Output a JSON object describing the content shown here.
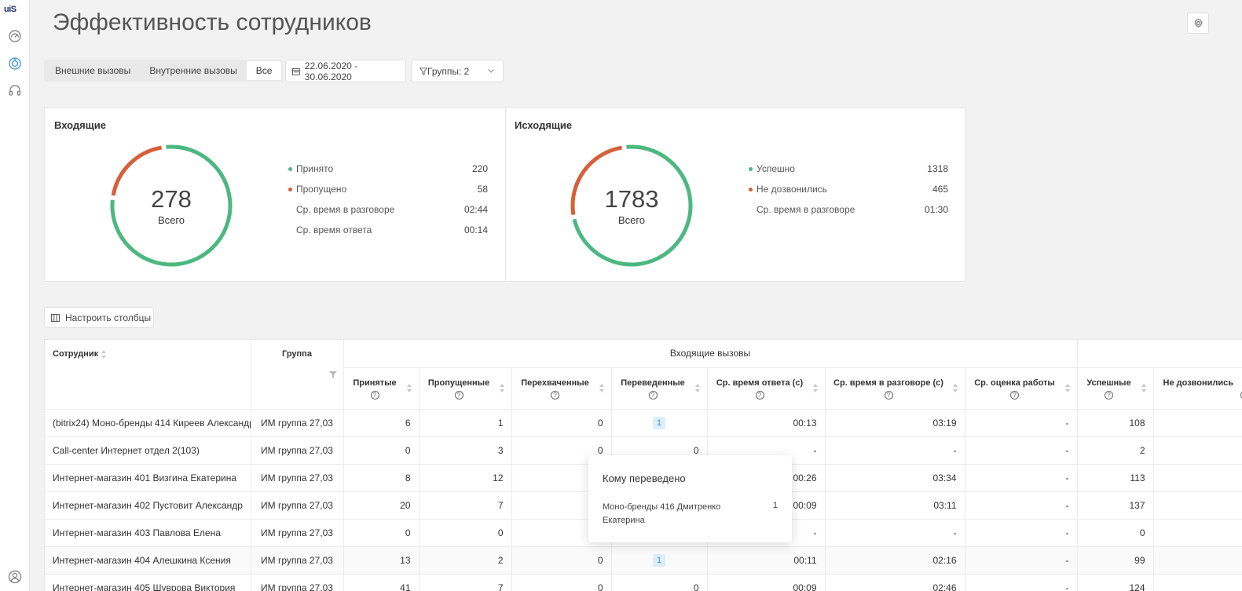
{
  "app": {
    "logo": "uiЅ"
  },
  "sidebar": {
    "icons": [
      "dashboard-icon",
      "analytics-icon",
      "headset-icon",
      "profile-icon"
    ],
    "accent": "#3b8fd2"
  },
  "header": {
    "title": "Эффективность сотрудников"
  },
  "filters": {
    "call_types": [
      "Внешние вызовы",
      "Внутренние вызовы",
      "Все"
    ],
    "selected_call_type": "Все",
    "date_range": "22.06.2020 - 30.06.2020",
    "groups": "Группы: 2"
  },
  "colors": {
    "success": "#4cb880",
    "failure": "#d5603a"
  },
  "incoming": {
    "title": "Входящие",
    "total": "278",
    "total_label": "Всего",
    "accepted_value": 220,
    "missed_value": 58,
    "legend": [
      {
        "label": "Принято",
        "value": "220",
        "color": "#4cb880"
      },
      {
        "label": "Пропущено",
        "value": "58",
        "color": "#d5603a"
      },
      {
        "label": "Ср. время в разговоре",
        "value": "02:44"
      },
      {
        "label": "Ср. время ответа",
        "value": "00:14"
      }
    ]
  },
  "outgoing": {
    "title": "Исходящие",
    "total": "1783",
    "total_label": "Всего",
    "success_value": 1318,
    "fail_value": 465,
    "legend": [
      {
        "label": "Успешно",
        "value": "1318",
        "color": "#4cb880"
      },
      {
        "label": "Не дозвонились",
        "value": "465",
        "color": "#d5603a"
      },
      {
        "label": "Ср. время в разговоре",
        "value": "01:30"
      }
    ]
  },
  "table_controls": {
    "configure_columns": "Настроить столбцы"
  },
  "table": {
    "col_employee": "Сотрудник",
    "col_group": "Группа",
    "incoming_group_title": "Входящие вызовы",
    "incoming_cols": [
      "Принятые",
      "Пропущенные",
      "Перехваченные",
      "Переведенные",
      "Ср. время ответа (с)",
      "Ср. время в разговоре (с)",
      "Ср. оценка работы"
    ],
    "outgoing_cols": [
      "Успешные",
      "Не дозвонились"
    ],
    "rows": [
      {
        "employee": "(bitrix24) Моно-бренды 414 Киреев Александр",
        "group": "ИМ группа 27,03",
        "accepted": "6",
        "missed": "1",
        "intercepted": "0",
        "transferred": "1",
        "avg_answer": "00:13",
        "avg_talk": "03:19",
        "rating": "-",
        "success": "108"
      },
      {
        "employee": "Call-center Интернет отдел 2(103)",
        "group": "ИМ группа 27,03",
        "accepted": "0",
        "missed": "3",
        "intercepted": "0",
        "transferred": "0",
        "avg_answer": "-",
        "avg_talk": "-",
        "rating": "-",
        "success": "2"
      },
      {
        "employee": "Интернет-магазин 401 Визгина Екатерина",
        "group": "ИМ группа 27,03",
        "accepted": "8",
        "missed": "12",
        "intercepted": "",
        "transferred": "",
        "avg_answer": "00:26",
        "avg_talk": "03:34",
        "rating": "-",
        "success": "113"
      },
      {
        "employee": "Интернет-магазин 402 Пустовит Александр",
        "group": "ИМ группа 27,03",
        "accepted": "20",
        "missed": "7",
        "intercepted": "",
        "transferred": "",
        "avg_answer": "00:09",
        "avg_talk": "03:11",
        "rating": "-",
        "success": "137"
      },
      {
        "employee": "Интернет-магазин 403 Павлова Елена",
        "group": "ИМ группа 27,03",
        "accepted": "0",
        "missed": "0",
        "intercepted": "",
        "transferred": "",
        "avg_answer": "-",
        "avg_talk": "-",
        "rating": "-",
        "success": "0"
      },
      {
        "employee": "Интернет-магазин 404 Алешкина Ксения",
        "group": "ИМ группа 27,03",
        "accepted": "13",
        "missed": "2",
        "intercepted": "0",
        "transferred": "1",
        "avg_answer": "00:11",
        "avg_talk": "02:16",
        "rating": "-",
        "success": "99"
      },
      {
        "employee": "Интернет-магазин 405 Шуврова Виктория",
        "group": "ИМ группа 27,03",
        "accepted": "41",
        "missed": "7",
        "intercepted": "0",
        "transferred": "0",
        "avg_answer": "00:09",
        "avg_talk": "02:46",
        "rating": "-",
        "success": "124"
      }
    ]
  },
  "tooltip": {
    "title": "Кому переведено",
    "name": "Моно-бренды 416 Дмитренко Екатерина",
    "count": "1"
  }
}
